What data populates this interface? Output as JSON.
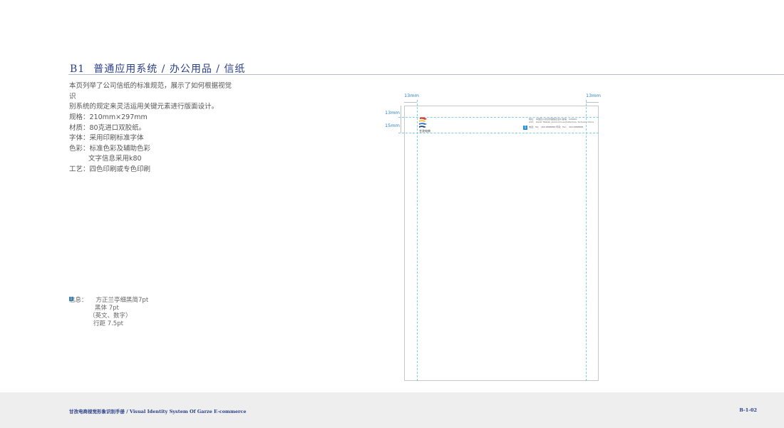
{
  "header": {
    "code": "B1",
    "title": "普通应用系统 / 办公用品 / 信纸"
  },
  "intro": {
    "line1": "本页列举了公司信纸的标准规范，展示了如何根据视觉识",
    "line2": "别系统的规定来灵活运用关键元素进行版面设计。"
  },
  "specs": {
    "size": "规格：210mm×297mm",
    "material": "材质：80克进口双胶纸。",
    "font": "字体：采用印刷标准字体",
    "color": "色彩：标准色彩及辅助色彩",
    "color_note": "文字信息采用k80",
    "process": "工艺：四色印刷或专色印刷"
  },
  "note": {
    "badge": "1",
    "label": "信息：",
    "font_primary": "方正兰亭细黑简7pt",
    "font_secondary": "黑体  7pt",
    "scope": "（英文、数字）",
    "line_spacing": "行距 7.5pt"
  },
  "diagram": {
    "margin_left": "13mm",
    "margin_right": "13mm",
    "margin_top": "13mm",
    "header_height": "15mm",
    "logo_text": "甘孜电商",
    "letterhead": {
      "badge": "1",
      "line1": "地址：  中国四川省甘孜藏族自治州      邮编：626000",
      "line2": "Add：  Ganzi Tibetan Autonomous Prefecture, Sichuan, China",
      "line3": "电话：Tel：   400-8888888   传真：Fax：  400-8888888"
    },
    "colors": {
      "logo_red": "#e23a2e",
      "logo_yellow": "#f2c230",
      "logo_blue": "#2a6fc8",
      "logo_navy": "#1f3d7a",
      "guide": "#7fcde8"
    }
  },
  "footer": {
    "left": "甘孜电商视觉形象识别手册 / Visual Identity System Of Garze E-commerce",
    "right": "B-1-02"
  }
}
